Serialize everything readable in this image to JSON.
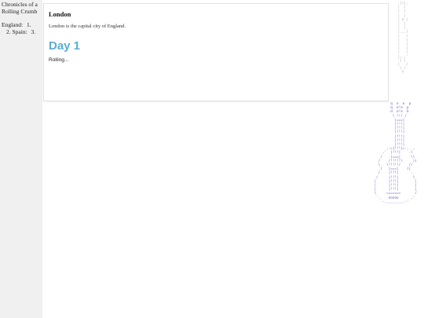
{
  "sidebar": {
    "title": "Chronicles of a Rolling Crumb",
    "items": [
      {
        "label": "England:",
        "number": "1."
      },
      {
        "label": "Spain:",
        "number": "3.",
        "prefix": "2."
      }
    ]
  },
  "card": {
    "title": "London",
    "text": "London is the capital city of England.",
    "day_heading": "Day 1",
    "status_text": "Rolling..."
  },
  "ascii": {
    "top_art": " ,|||,\n |  |\n |  |\n |  |\n | o |\n |  |\n |  |\n |___|\n |   )\n |   |\n |   |\n |   |\n |   |\n |,_,'\n '| |\n (   )\n  \\ /\n   Y",
    "guitar_art": "         q  o  o  p\n         q  o!o  p\n         d  o!o  b\n          \\ !!! /\n           |===|\n           |!!!|\n           |!!!|\n           |!!!|\n           |!!!|\n           |!!!|\n           |!!!|\n       ,-=|!!!|=-.  ,\n     ,'  |!!!|   `.\\\n    /    |===|     \\\\\n   /    /!!!!!\\     ))\n   \\   \\!!!!!/    //\n    )   |===|    ((\n   /    |!!!|     `.\n  /     |!!!|       \\\n |      |!!!|        |\n |      |!!!|        |\n |      |!!!|        |\n \\     =======       /\n  `.    ooooo      ,'\n    `-.________.-'",
    "colors": {
      "top": "#aaaaaa",
      "guitar": "#6a5acd"
    }
  },
  "colors": {
    "sidebar_bg": "#f0f0f0",
    "accent": "#5aaed2"
  }
}
